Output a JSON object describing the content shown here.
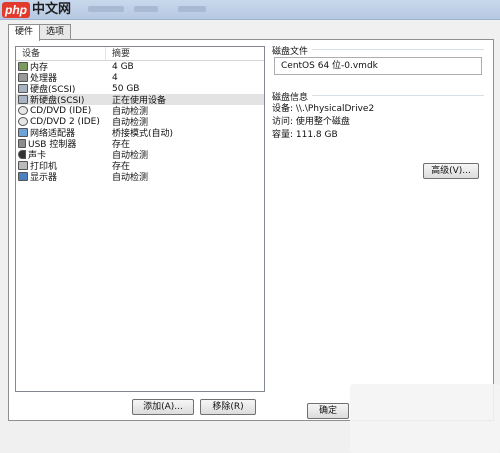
{
  "titlebar": {
    "logo_php": "php",
    "logo_cn": "中文网"
  },
  "tabs": [
    {
      "label": "硬件",
      "active": true
    },
    {
      "label": "选项",
      "active": false
    }
  ],
  "device_list": {
    "headers": {
      "device": "设备",
      "summary": "摘要"
    },
    "rows": [
      {
        "icon": "memory-icon",
        "device": "内存",
        "summary": "4 GB",
        "selected": false
      },
      {
        "icon": "processor-icon",
        "device": "处理器",
        "summary": "4",
        "selected": false
      },
      {
        "icon": "hard-disk-icon",
        "device": "硬盘(SCSI)",
        "summary": "50 GB",
        "selected": false
      },
      {
        "icon": "hard-disk-icon",
        "device": "新硬盘(SCSI)",
        "summary": "正在使用设备",
        "selected": true
      },
      {
        "icon": "cd-dvd-icon",
        "device": "CD/DVD (IDE)",
        "summary": "自动检测",
        "selected": false
      },
      {
        "icon": "cd-dvd-icon",
        "device": "CD/DVD 2 (IDE)",
        "summary": "自动检测",
        "selected": false
      },
      {
        "icon": "network-adapter-icon",
        "device": "网络适配器",
        "summary": "桥接模式(自动)",
        "selected": false
      },
      {
        "icon": "usb-icon",
        "device": "USB 控制器",
        "summary": "存在",
        "selected": false
      },
      {
        "icon": "sound-icon",
        "device": "声卡",
        "summary": "自动检测",
        "selected": false
      },
      {
        "icon": "printer-icon",
        "device": "打印机",
        "summary": "存在",
        "selected": false
      },
      {
        "icon": "display-icon",
        "device": "显示器",
        "summary": "自动检测",
        "selected": false
      }
    ],
    "add_button": "添加(A)...",
    "remove_button": "移除(R)"
  },
  "disk_file": {
    "group_title": "磁盘文件",
    "value": "CentOS 64 位-0.vmdk"
  },
  "disk_info": {
    "group_title": "磁盘信息",
    "device": "设备: \\\\.\\PhysicalDrive2",
    "access": "访问: 使用整个磁盘",
    "capacity": "容量: 111.8 GB"
  },
  "advanced_button": "高级(V)...",
  "ok_button": "确定"
}
